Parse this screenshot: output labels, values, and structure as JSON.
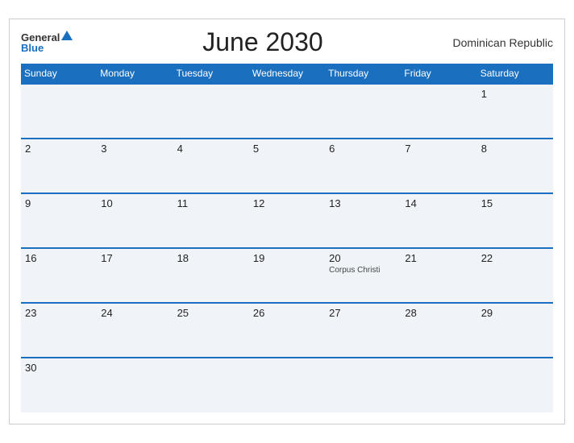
{
  "header": {
    "logo_general": "General",
    "logo_blue": "Blue",
    "title": "June 2030",
    "country": "Dominican Republic"
  },
  "weekdays": [
    "Sunday",
    "Monday",
    "Tuesday",
    "Wednesday",
    "Thursday",
    "Friday",
    "Saturday"
  ],
  "weeks": [
    [
      {
        "date": "",
        "event": ""
      },
      {
        "date": "",
        "event": ""
      },
      {
        "date": "",
        "event": ""
      },
      {
        "date": "",
        "event": ""
      },
      {
        "date": "",
        "event": ""
      },
      {
        "date": "",
        "event": ""
      },
      {
        "date": "1",
        "event": ""
      }
    ],
    [
      {
        "date": "2",
        "event": ""
      },
      {
        "date": "3",
        "event": ""
      },
      {
        "date": "4",
        "event": ""
      },
      {
        "date": "5",
        "event": ""
      },
      {
        "date": "6",
        "event": ""
      },
      {
        "date": "7",
        "event": ""
      },
      {
        "date": "8",
        "event": ""
      }
    ],
    [
      {
        "date": "9",
        "event": ""
      },
      {
        "date": "10",
        "event": ""
      },
      {
        "date": "11",
        "event": ""
      },
      {
        "date": "12",
        "event": ""
      },
      {
        "date": "13",
        "event": ""
      },
      {
        "date": "14",
        "event": ""
      },
      {
        "date": "15",
        "event": ""
      }
    ],
    [
      {
        "date": "16",
        "event": ""
      },
      {
        "date": "17",
        "event": ""
      },
      {
        "date": "18",
        "event": ""
      },
      {
        "date": "19",
        "event": ""
      },
      {
        "date": "20",
        "event": "Corpus Christi"
      },
      {
        "date": "21",
        "event": ""
      },
      {
        "date": "22",
        "event": ""
      }
    ],
    [
      {
        "date": "23",
        "event": ""
      },
      {
        "date": "24",
        "event": ""
      },
      {
        "date": "25",
        "event": ""
      },
      {
        "date": "26",
        "event": ""
      },
      {
        "date": "27",
        "event": ""
      },
      {
        "date": "28",
        "event": ""
      },
      {
        "date": "29",
        "event": ""
      }
    ],
    [
      {
        "date": "30",
        "event": ""
      },
      {
        "date": "",
        "event": ""
      },
      {
        "date": "",
        "event": ""
      },
      {
        "date": "",
        "event": ""
      },
      {
        "date": "",
        "event": ""
      },
      {
        "date": "",
        "event": ""
      },
      {
        "date": "",
        "event": ""
      }
    ]
  ]
}
